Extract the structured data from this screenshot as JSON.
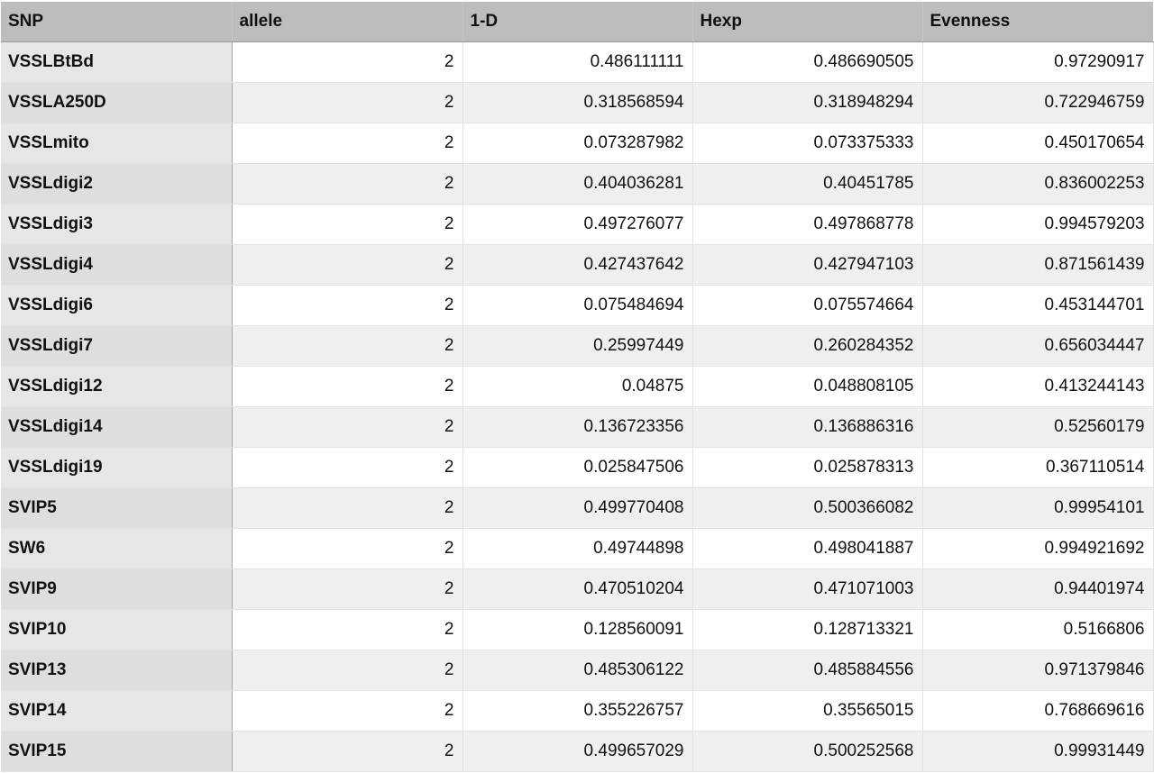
{
  "table": {
    "headers": [
      "SNP",
      "allele",
      "1-D",
      "Hexp",
      "Evenness"
    ],
    "rows": [
      [
        "VSSLBtBd",
        "2",
        "0.486111111",
        "0.486690505",
        "0.97290917"
      ],
      [
        "VSSLA250D",
        "2",
        "0.318568594",
        "0.318948294",
        "0.722946759"
      ],
      [
        "VSSLmito",
        "2",
        "0.073287982",
        "0.073375333",
        "0.450170654"
      ],
      [
        "VSSLdigi2",
        "2",
        "0.404036281",
        "0.40451785",
        "0.836002253"
      ],
      [
        "VSSLdigi3",
        "2",
        "0.497276077",
        "0.497868778",
        "0.994579203"
      ],
      [
        "VSSLdigi4",
        "2",
        "0.427437642",
        "0.427947103",
        "0.871561439"
      ],
      [
        "VSSLdigi6",
        "2",
        "0.075484694",
        "0.075574664",
        "0.453144701"
      ],
      [
        "VSSLdigi7",
        "2",
        "0.25997449",
        "0.260284352",
        "0.656034447"
      ],
      [
        "VSSLdigi12",
        "2",
        "0.04875",
        "0.048808105",
        "0.413244143"
      ],
      [
        "VSSLdigi14",
        "2",
        "0.136723356",
        "0.136886316",
        "0.52560179"
      ],
      [
        "VSSLdigi19",
        "2",
        "0.025847506",
        "0.025878313",
        "0.367110514"
      ],
      [
        "SVIP5",
        "2",
        "0.499770408",
        "0.500366082",
        "0.99954101"
      ],
      [
        "SW6",
        "2",
        "0.49744898",
        "0.498041887",
        "0.994921692"
      ],
      [
        "SVIP9",
        "2",
        "0.470510204",
        "0.471071003",
        "0.94401974"
      ],
      [
        "SVIP10",
        "2",
        "0.128560091",
        "0.128713321",
        "0.5166806"
      ],
      [
        "SVIP13",
        "2",
        "0.485306122",
        "0.485884556",
        "0.971379846"
      ],
      [
        "SVIP14",
        "2",
        "0.355226757",
        "0.35565015",
        "0.768669616"
      ],
      [
        "SVIP15",
        "2",
        "0.499657029",
        "0.500252568",
        "0.99931449"
      ]
    ]
  }
}
